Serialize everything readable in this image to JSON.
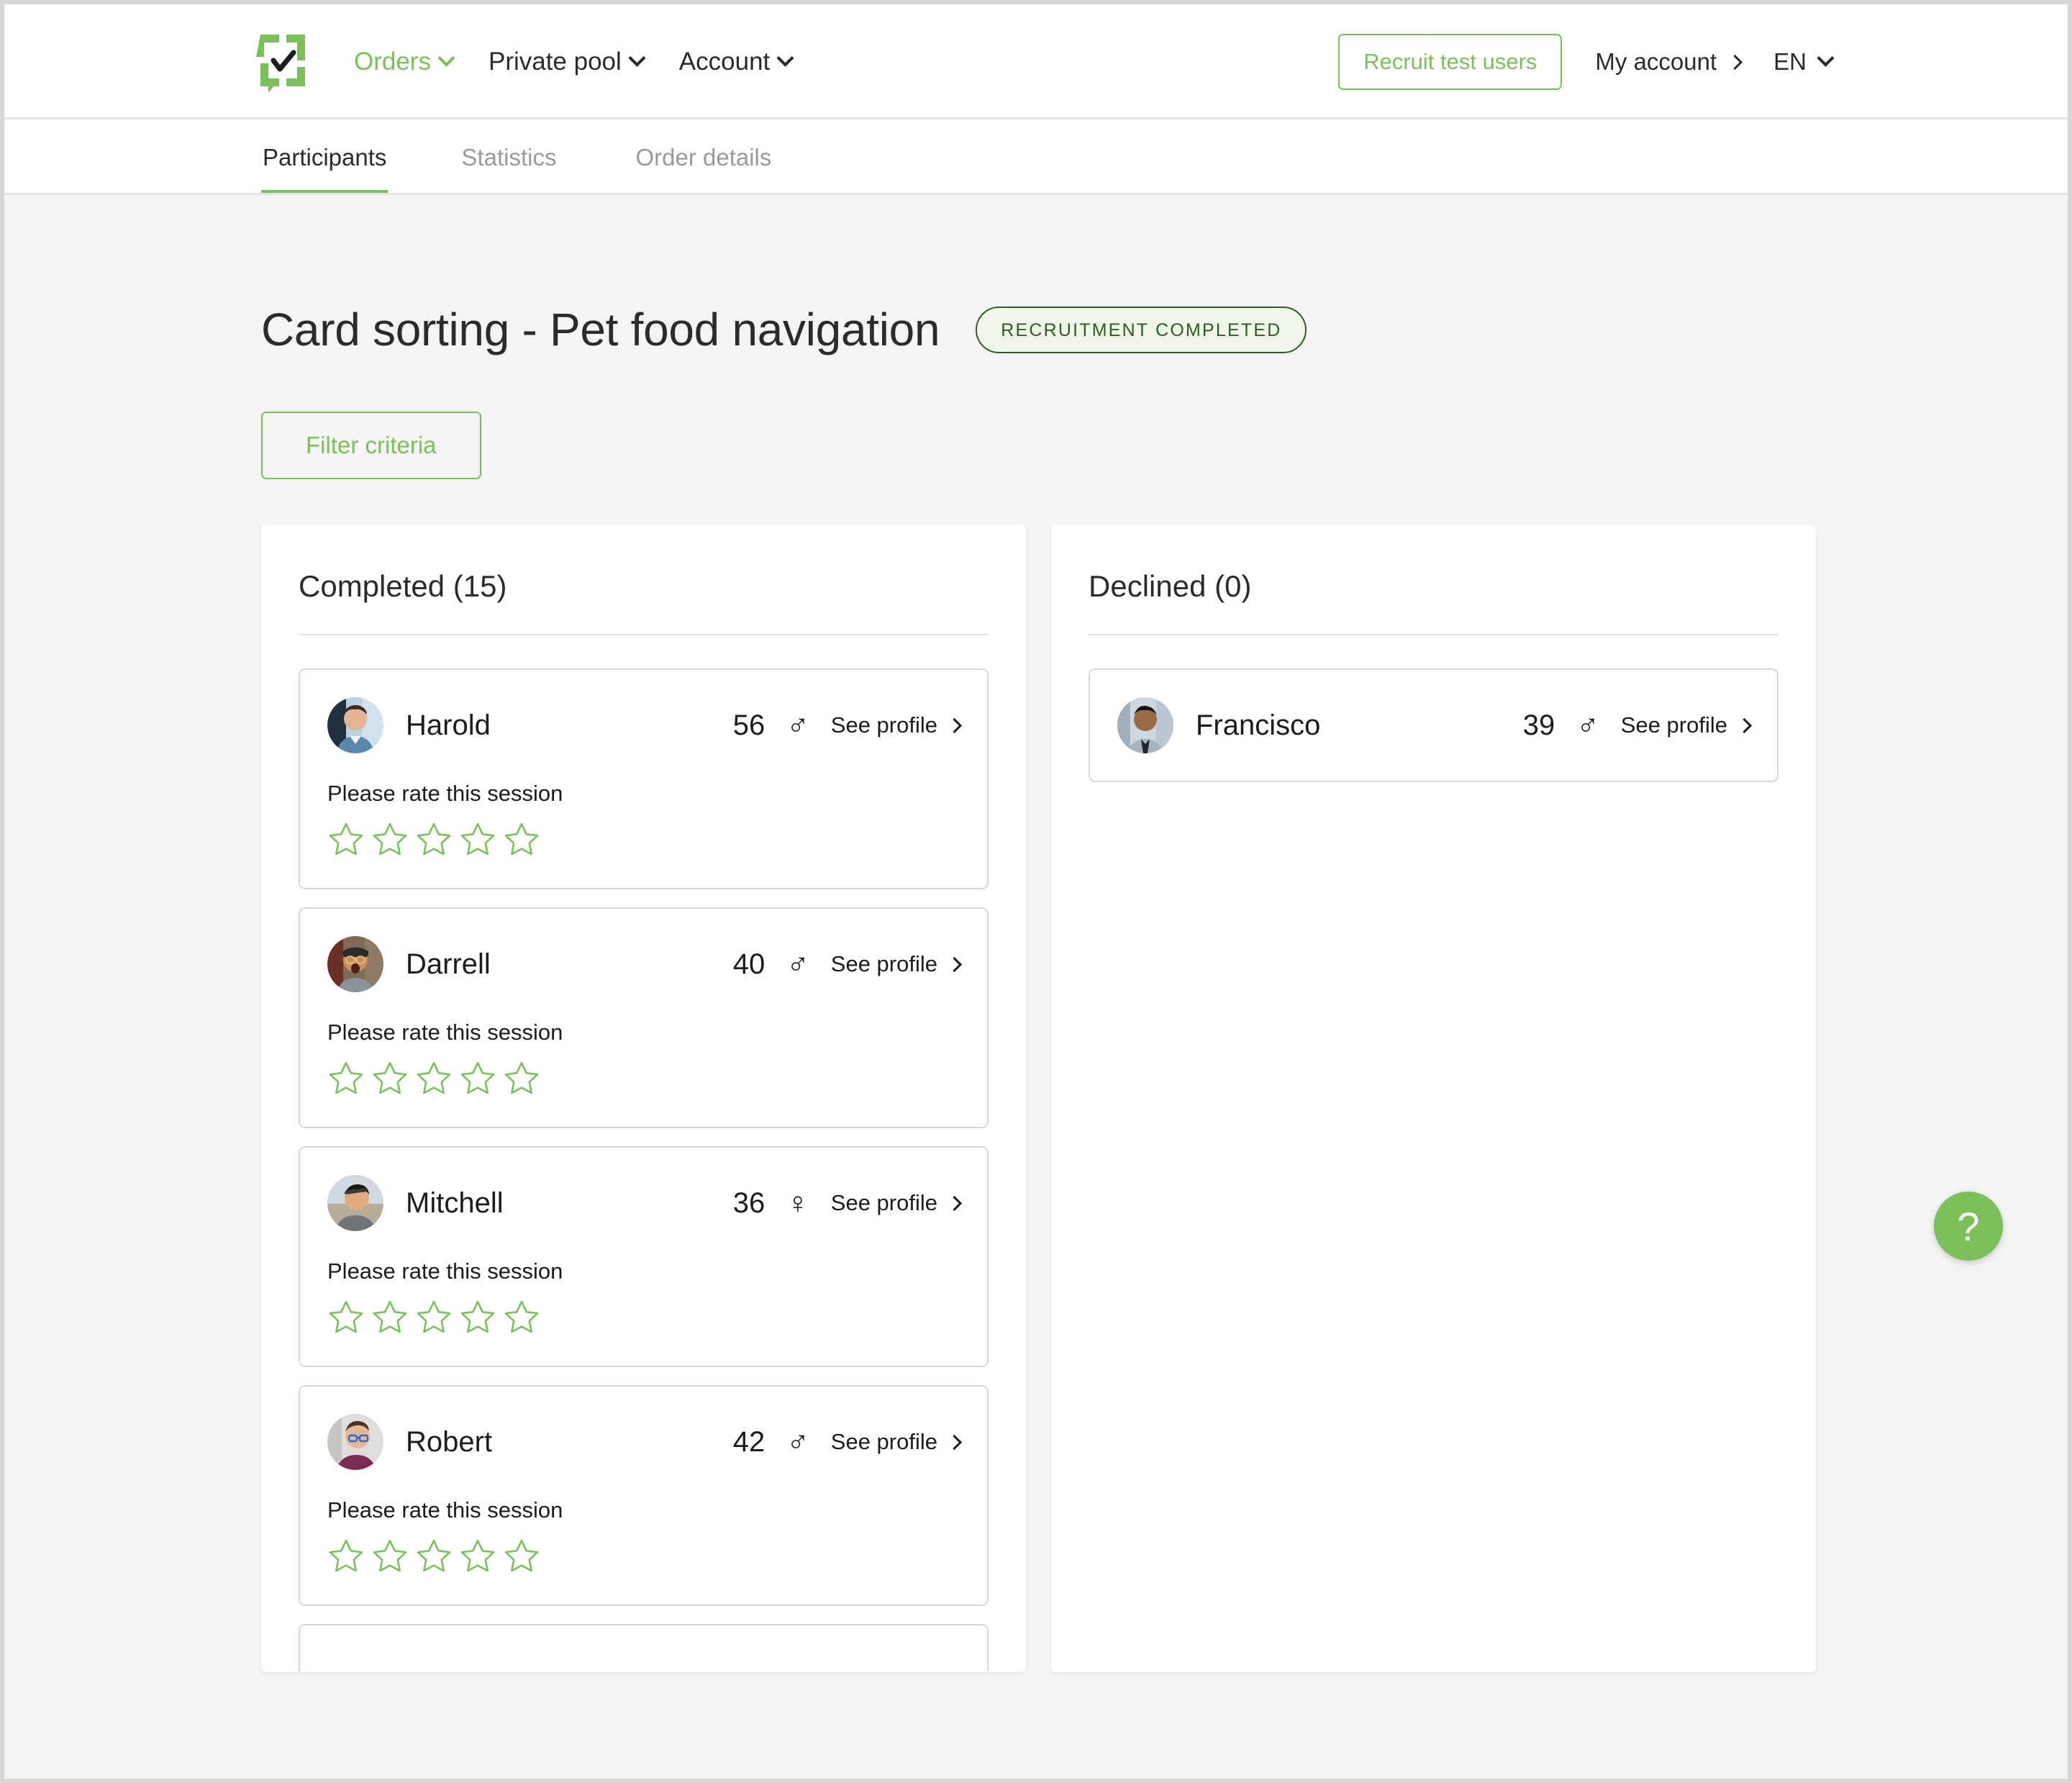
{
  "brand": {
    "logo_icon": "speech-bubble-check-logo"
  },
  "topnav": {
    "items": [
      {
        "label": "Orders",
        "active": true
      },
      {
        "label": "Private pool",
        "active": false
      },
      {
        "label": "Account",
        "active": false
      }
    ],
    "recruit_button": "Recruit test users",
    "account_label": "My account",
    "language_label": "EN"
  },
  "tabs": [
    {
      "label": "Participants",
      "active": true
    },
    {
      "label": "Statistics",
      "active": false
    },
    {
      "label": "Order details",
      "active": false
    }
  ],
  "page": {
    "title": "Card sorting - Pet food navigation",
    "status_badge": "RECRUITMENT COMPLETED",
    "filter_button": "Filter criteria"
  },
  "colors": {
    "accent_green": "#7ac159",
    "badge_border": "#2f5c23",
    "badge_fill": "#eef6e9",
    "page_background": "#f4f4f4",
    "card_border": "#d8d8d8"
  },
  "completed": {
    "title": "Completed (15)",
    "participants": [
      {
        "name": "Harold",
        "age": "56",
        "gender": "♂",
        "gender_name": "male",
        "see_profile": "See profile",
        "rate_label": "Please rate this session",
        "stars": 5,
        "rating": 0
      },
      {
        "name": "Darrell",
        "age": "40",
        "gender": "♂",
        "gender_name": "male",
        "see_profile": "See profile",
        "rate_label": "Please rate this session",
        "stars": 5,
        "rating": 0
      },
      {
        "name": "Mitchell",
        "age": "36",
        "gender": "♀",
        "gender_name": "female",
        "see_profile": "See profile",
        "rate_label": "Please rate this session",
        "stars": 5,
        "rating": 0
      },
      {
        "name": "Robert",
        "age": "42",
        "gender": "♂",
        "gender_name": "male",
        "see_profile": "See profile",
        "rate_label": "Please rate this session",
        "stars": 5,
        "rating": 0
      }
    ]
  },
  "declined": {
    "title": "Declined (0)",
    "participants": [
      {
        "name": "Francisco",
        "age": "39",
        "gender": "♂",
        "gender_name": "male",
        "see_profile": "See profile"
      }
    ]
  },
  "help": {
    "label": "?"
  }
}
